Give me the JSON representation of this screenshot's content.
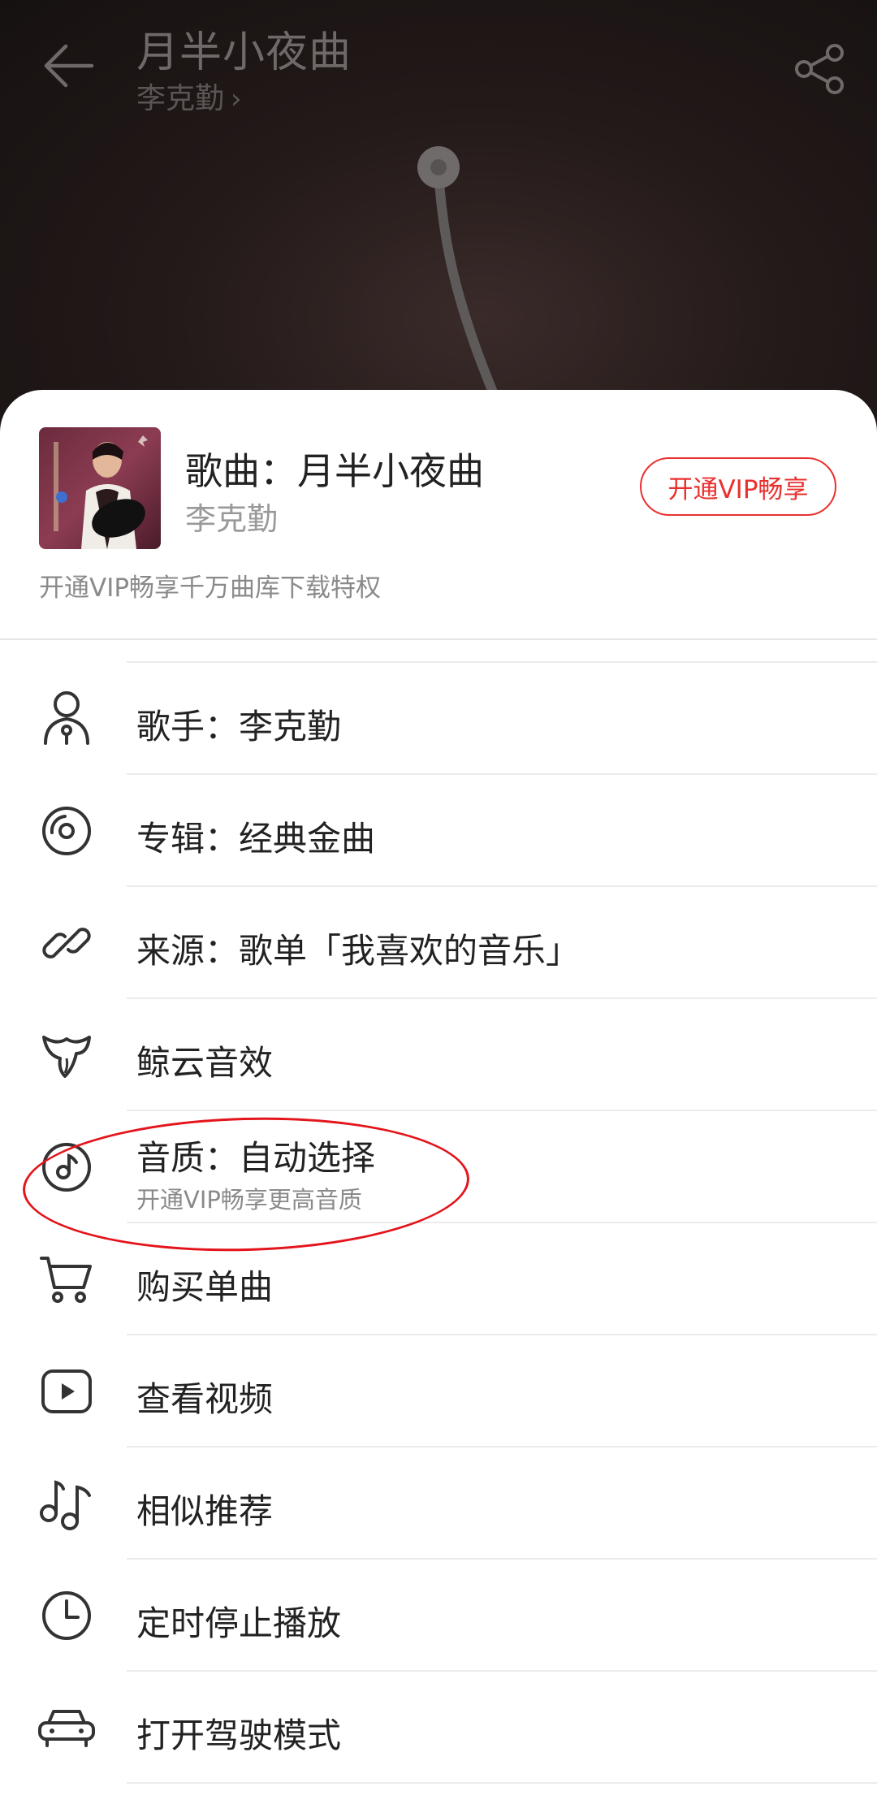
{
  "player": {
    "title": "月半小夜曲",
    "artist": "李克勤",
    "artist_chevron": "›"
  },
  "sheet": {
    "song_line": "歌曲：月半小夜曲",
    "artist": "李克勤",
    "vip_button": "开通VIP畅享",
    "promo": "开通VIP畅享千万曲库下载特权"
  },
  "menu": [
    {
      "id": "artist",
      "icon": "person-icon",
      "label": "歌手：李克勤"
    },
    {
      "id": "album",
      "icon": "disc-icon",
      "label": "专辑：经典金曲"
    },
    {
      "id": "source",
      "icon": "link-icon",
      "label": "来源：歌单「我喜欢的音乐」"
    },
    {
      "id": "effects",
      "icon": "whale-cloud-icon",
      "label": "鲸云音效"
    },
    {
      "id": "quality",
      "icon": "music-disc-icon",
      "label": "音质：自动选择",
      "sub": "开通VIP畅享更高音质"
    },
    {
      "id": "buy",
      "icon": "cart-icon",
      "label": "购买单曲"
    },
    {
      "id": "video",
      "icon": "play-video-icon",
      "label": "查看视频"
    },
    {
      "id": "similar",
      "icon": "music-notes-icon",
      "label": "相似推荐"
    },
    {
      "id": "timer",
      "icon": "clock-icon",
      "label": "定时停止播放"
    },
    {
      "id": "drive",
      "icon": "car-icon",
      "label": "打开驾驶模式"
    }
  ],
  "colors": {
    "accent": "#e8312f",
    "annotation": "#e4141b"
  }
}
